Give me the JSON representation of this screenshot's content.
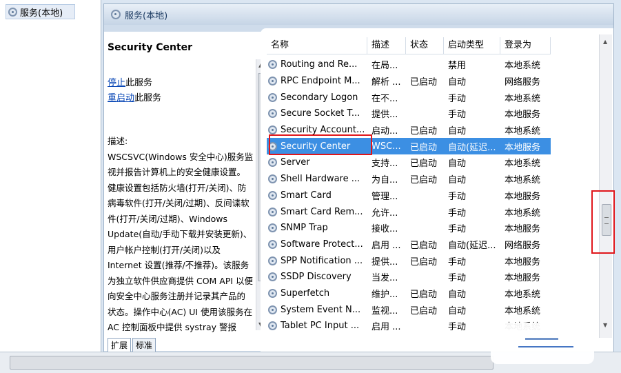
{
  "tree": {
    "node_label": "服务(本地)"
  },
  "header": {
    "title": "服务(本地)"
  },
  "description": {
    "service_name": "Security Center",
    "stop_link": "停止",
    "stop_suffix": "此服务",
    "restart_link": "重启动",
    "restart_suffix": "此服务",
    "body": "描述:\nWSCSVC(Windows 安全中心)服务监视并报告计算机上的安全健康设置。健康设置包括防火墙(打开/关闭)、防病毒软件(打开/关闭/过期)、反间谍软件(打开/关闭/过期)、Windows Update(自动/手动下载并安装更新)、用户帐户控制(打开/关闭)以及 Internet 设置(推荐/不推荐)。该服务为独立软件供应商提供 COM API 以便向安全中心服务注册并记录其产品的状态。操作中心(AC) UI 使用该服务在 AC 控制面板中提供 systray 警报"
  },
  "tabs": [
    {
      "label": "扩展"
    },
    {
      "label": "标准"
    }
  ],
  "columns": {
    "name": "名称",
    "desc": "描述",
    "status": "状态",
    "startup": "启动类型",
    "logon": "登录为"
  },
  "sort_indicator": "^",
  "services": [
    {
      "name": "Routing and Re...",
      "desc": "在局...",
      "status": "",
      "startup": "禁用",
      "logon": "本地系统"
    },
    {
      "name": "RPC Endpoint M...",
      "desc": "解析 ...",
      "status": "已启动",
      "startup": "自动",
      "logon": "网络服务"
    },
    {
      "name": "Secondary Logon",
      "desc": "在不...",
      "status": "",
      "startup": "手动",
      "logon": "本地系统"
    },
    {
      "name": "Secure Socket T...",
      "desc": "提供...",
      "status": "",
      "startup": "手动",
      "logon": "本地服务"
    },
    {
      "name": "Security Account...",
      "desc": "启动...",
      "status": "已启动",
      "startup": "自动",
      "logon": "本地系统"
    },
    {
      "name": "Security Center",
      "desc": "WSC...",
      "status": "已启动",
      "startup": "自动(延迟...",
      "logon": "本地服务",
      "selected": true
    },
    {
      "name": "Server",
      "desc": "支持...",
      "status": "已启动",
      "startup": "自动",
      "logon": "本地系统"
    },
    {
      "name": "Shell Hardware ...",
      "desc": "为自...",
      "status": "已启动",
      "startup": "自动",
      "logon": "本地系统"
    },
    {
      "name": "Smart Card",
      "desc": "管理...",
      "status": "",
      "startup": "手动",
      "logon": "本地服务"
    },
    {
      "name": "Smart Card Rem...",
      "desc": "允许...",
      "status": "",
      "startup": "手动",
      "logon": "本地系统"
    },
    {
      "name": "SNMP Trap",
      "desc": "接收...",
      "status": "",
      "startup": "手动",
      "logon": "本地服务"
    },
    {
      "name": "Software Protect...",
      "desc": "启用 ...",
      "status": "已启动",
      "startup": "自动(延迟...",
      "logon": "网络服务"
    },
    {
      "name": "SPP Notification ...",
      "desc": "提供...",
      "status": "已启动",
      "startup": "手动",
      "logon": "本地服务"
    },
    {
      "name": "SSDP Discovery",
      "desc": "当发...",
      "status": "",
      "startup": "手动",
      "logon": "本地服务"
    },
    {
      "name": "Superfetch",
      "desc": "维护...",
      "status": "已启动",
      "startup": "自动",
      "logon": "本地系统"
    },
    {
      "name": "System Event N...",
      "desc": "监视...",
      "status": "已启动",
      "startup": "自动",
      "logon": "本地系统"
    },
    {
      "name": "Tablet PC Input ...",
      "desc": "启用 ...",
      "status": "",
      "startup": "手动",
      "logon": "本地系统"
    }
  ],
  "colors": {
    "selection": "#3c8fe3",
    "highlight_box": "#e0161b",
    "link": "#0645b5"
  }
}
